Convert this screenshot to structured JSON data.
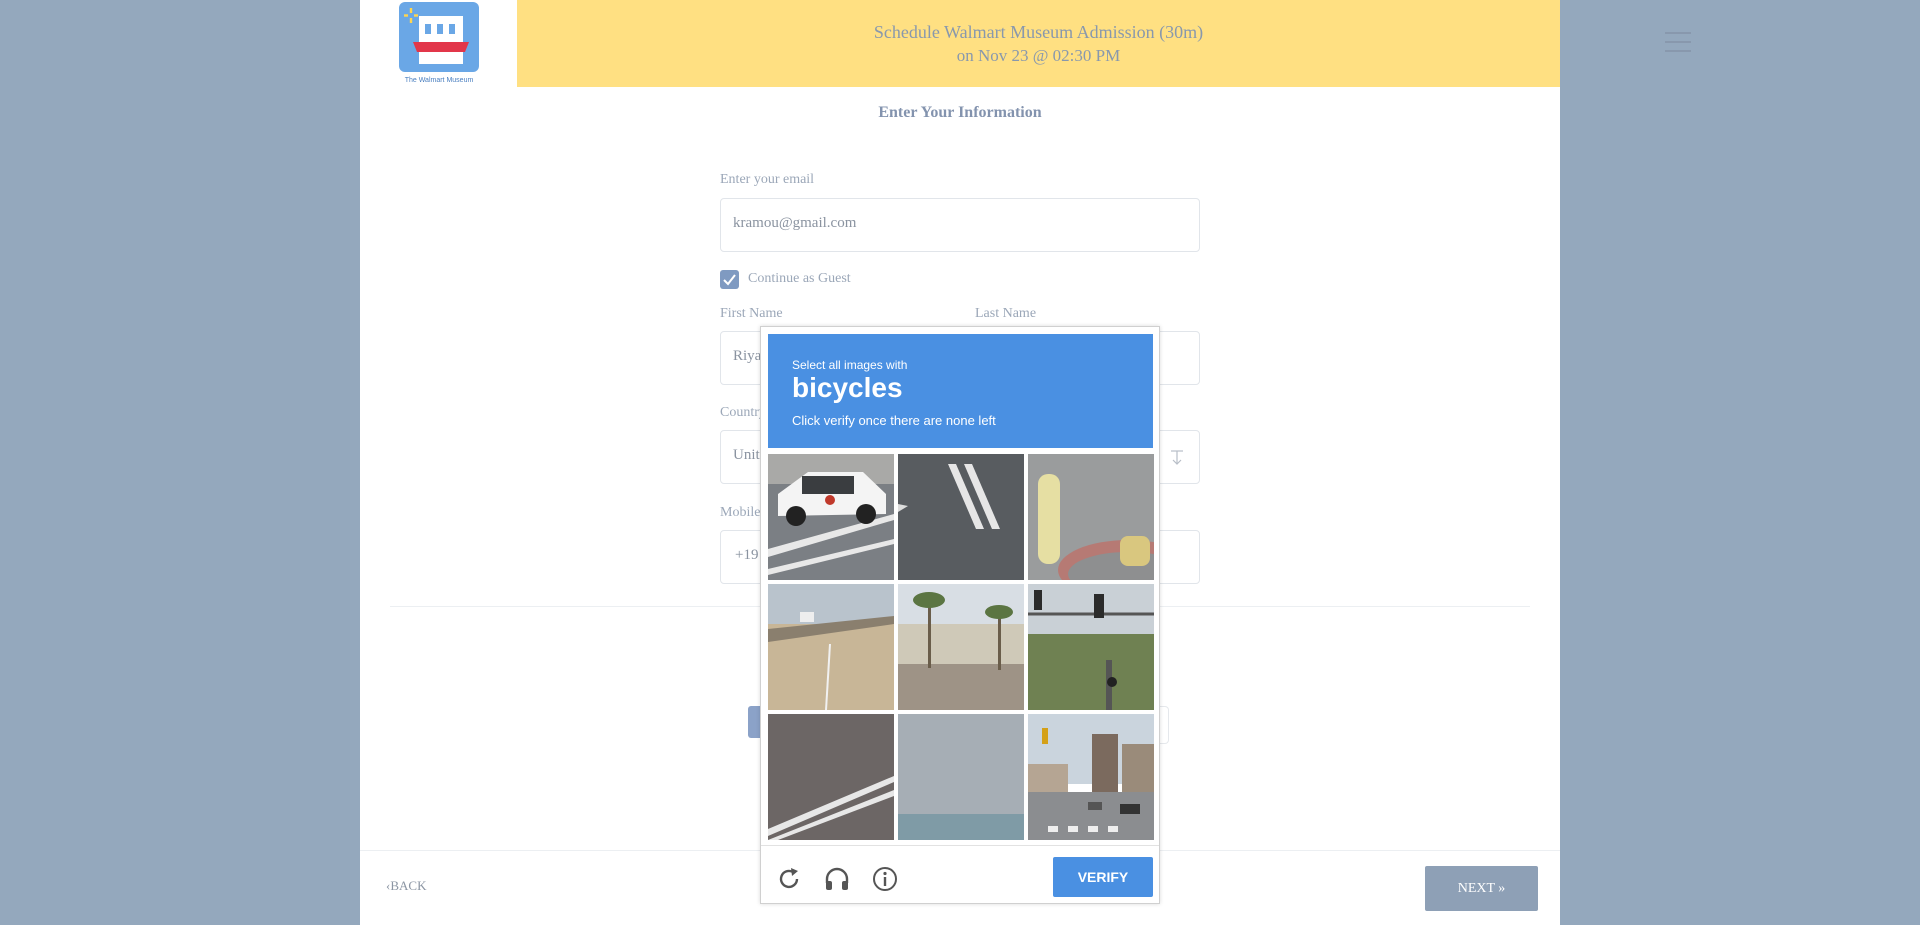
{
  "header": {
    "title_line1": "Schedule Walmart Museum Admission (30m)",
    "title_line2": "on Nov 23 @ 02:30 PM",
    "logo_text": "The Walmart Museum"
  },
  "section_title": "Enter Your Information",
  "form": {
    "email_label": "Enter your email",
    "email_value": "kramou@gmail.com",
    "guest_label": "Continue as Guest",
    "guest_checked": true,
    "first_name_label": "First Name",
    "first_name_value": "Riya",
    "last_name_label": "Last Name",
    "country_label": "Country",
    "country_value": "Unit",
    "mobile_label": "Mobile",
    "mobile_value": "+19"
  },
  "nav": {
    "back_label": "BACK",
    "next_label": "NEXT"
  },
  "captcha": {
    "instruction_line1": "Select all images with",
    "target": "bicycles",
    "instruction_line2": "Click verify once there are none left",
    "verify_label": "VERIFY",
    "tiles": [
      "car on road",
      "road with lane markings",
      "yellow bollard",
      "bridge highway",
      "palm trees street",
      "traffic signal intersection",
      "road lines",
      "sky and water",
      "city street intersection"
    ],
    "accent_color": "#4a90e2"
  }
}
